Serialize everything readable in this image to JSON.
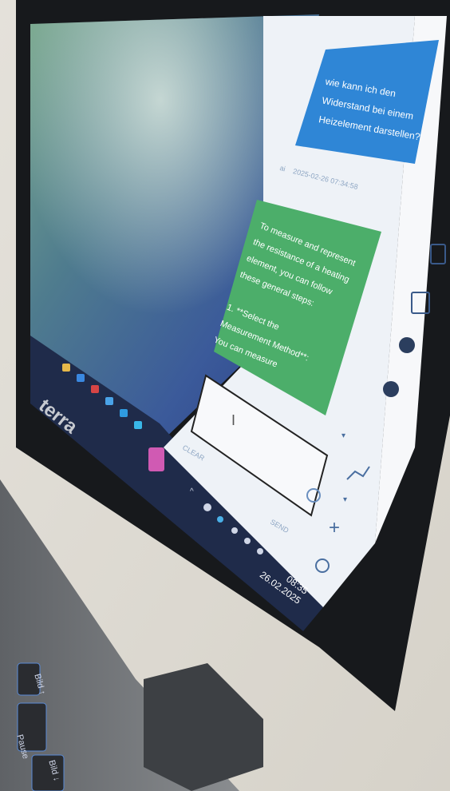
{
  "chat": {
    "user_message": [
      "wie kann ich den",
      "Widerstand bei einem",
      "Heizelement darstellen?"
    ],
    "ai_label": "ai",
    "ai_timestamp": "2025-02-26 07:34:58",
    "ai_message": [
      "To measure and represent",
      "the resistance of a heating",
      "element, you can follow",
      "these general steps:",
      "",
      "1. **Select the",
      "Measurement Method**:",
      "You can measure"
    ],
    "clear_label": "CLEAR",
    "send_label": "SEND"
  },
  "taskbar": {
    "time": "08:35",
    "date": "26.02.2025"
  },
  "laptop": {
    "brand": "terra",
    "keys": [
      "Bild ↑",
      "Pause",
      "Bild ↓"
    ]
  },
  "colors": {
    "user_bubble": "#2f86d6",
    "ai_bubble": "#4cae6a",
    "panel": "#eef2f7",
    "taskbar": "#1f2b4a",
    "bezel": "#17191c"
  }
}
